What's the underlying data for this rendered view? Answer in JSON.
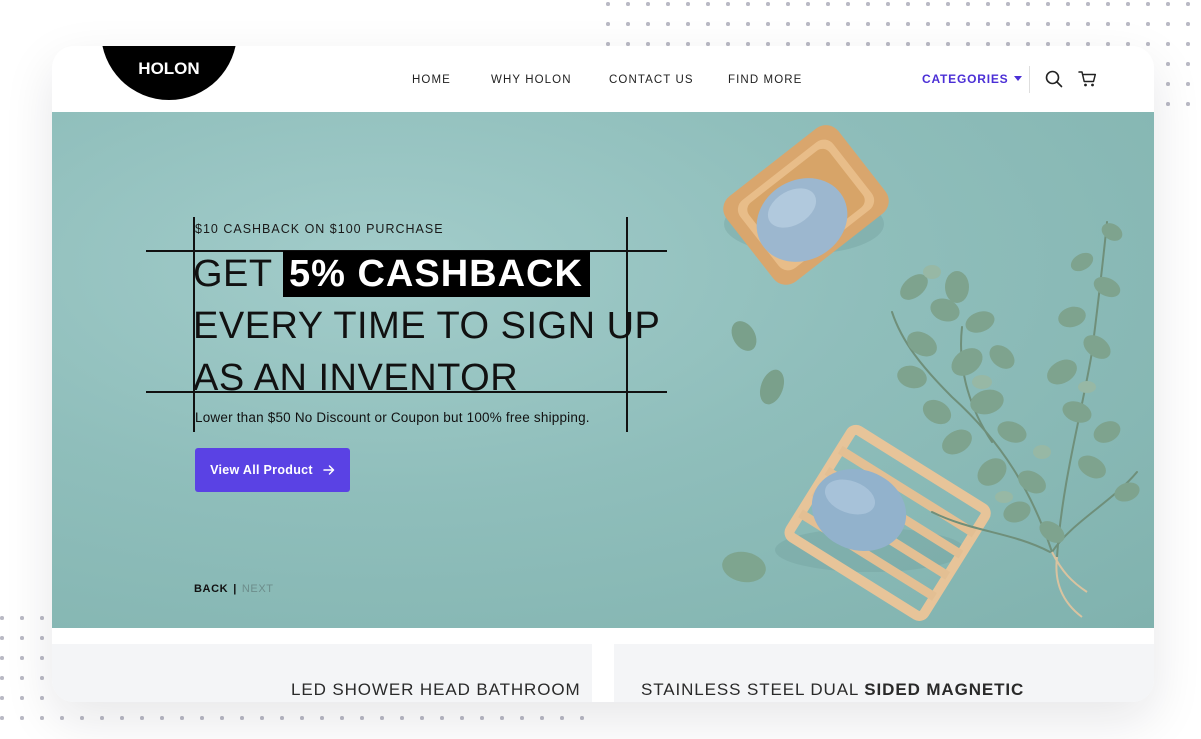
{
  "brand": {
    "logo_text": "HOLON"
  },
  "nav": {
    "links": [
      "HOME",
      "WHY HOLON",
      "CONTACT US",
      "FIND MORE"
    ],
    "categories_label": "CATEGORIES",
    "icons": [
      "search-icon",
      "cart-icon"
    ]
  },
  "hero": {
    "promo_small": "$10 CASHBACK ON $100 PURCHASE",
    "headline_prefix": "GET",
    "headline_highlight": "5% CASHBACK",
    "headline_line2": "EVERY TIME TO SIGN UP",
    "headline_line3": "AS AN INVENTOR",
    "subtext": "Lower than $50 No Discount or Coupon but 100% free shipping.",
    "cta_label": "View All Product",
    "cta_icon": "arrow-right-icon",
    "pager_back": "BACK",
    "pager_separator": "|",
    "pager_next": "NEXT"
  },
  "products": [
    {
      "title": "LED SHOWER HEAD BATHROOM"
    },
    {
      "title_regular": "STAINLESS STEEL DUAL",
      "title_bold": "SIDED MAGNETIC"
    }
  ],
  "colors": {
    "accent": "#5a42e4",
    "categories": "#4b2fd6",
    "hero_bg": "#8fbebb",
    "highlight_bg": "#000000"
  }
}
